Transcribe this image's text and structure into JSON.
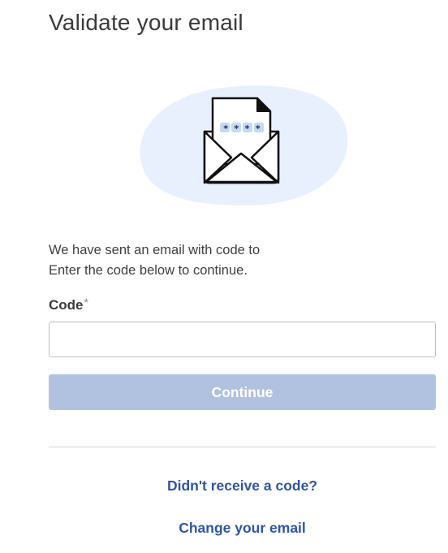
{
  "header": {
    "title": "Validate your email"
  },
  "illustration": {
    "icon": "open-envelope-with-code-letter-icon",
    "code_mask": "* * * *",
    "blob_color": "#e9f0fd",
    "dot_color": "#c5d8f7"
  },
  "message": {
    "line1": "We have sent an email with code to",
    "line2": "Enter the code below to continue."
  },
  "form": {
    "code_label": "Code",
    "required_mark": "*",
    "code_value": "",
    "code_placeholder": "",
    "continue_label": "Continue"
  },
  "links": {
    "resend": "Didn't receive a code?",
    "change_email": "Change your email"
  },
  "colors": {
    "primary_link": "#2f55a4",
    "button_disabled": "#b1c2e0",
    "title": "#3a3a3a"
  }
}
